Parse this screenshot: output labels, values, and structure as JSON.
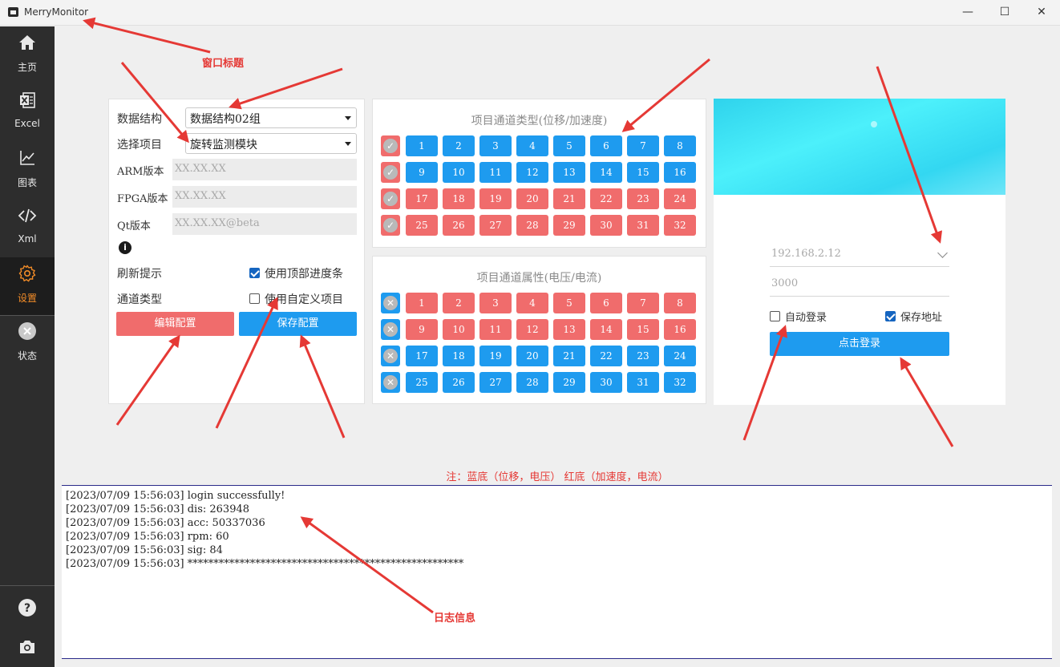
{
  "window": {
    "title": "MerryMonitor",
    "minimize": "—",
    "maximize": "☐",
    "close": "✕"
  },
  "sidebar": {
    "items": [
      {
        "label": "主页",
        "icon": "home-icon"
      },
      {
        "label": "Excel",
        "icon": "excel-icon"
      },
      {
        "label": "图表",
        "icon": "chart-icon"
      },
      {
        "label": "Xml",
        "icon": "code-icon"
      },
      {
        "label": "设置",
        "icon": "gear-icon",
        "active": true
      },
      {
        "label": "状态",
        "icon": "status-icon"
      }
    ],
    "accent": "#f28c28",
    "bottom": [
      "help-icon",
      "camera-icon"
    ]
  },
  "config": {
    "data_structure_label": "数据结构",
    "data_structure_value": "数据结构02组",
    "project_label": "选择项目",
    "project_value": "旋转监测模块",
    "arm_label": "ARM版本",
    "arm_value": "XX.XX.XX",
    "fpga_label": "FPGA版本",
    "fpga_value": "XX.XX.XX",
    "qt_label": "Qt版本",
    "qt_value": "XX.XX.XX@beta",
    "refresh_label": "刷新提示",
    "channel_label": "通道类型",
    "use_progress": {
      "label": "使用顶部进度条",
      "checked": true
    },
    "use_custom": {
      "label": "使用自定义项目",
      "checked": false
    },
    "edit_button": "编辑配置",
    "save_button": "保存配置"
  },
  "channel_type": {
    "title": "项目通道类型(位移/加速度)",
    "rows": [
      {
        "toggle": "check",
        "color": "red",
        "channels": [
          "1",
          "2",
          "3",
          "4",
          "5",
          "6",
          "7",
          "8"
        ],
        "cell_color": "blue"
      },
      {
        "toggle": "check",
        "color": "red",
        "channels": [
          "9",
          "10",
          "11",
          "12",
          "13",
          "14",
          "15",
          "16"
        ],
        "cell_color": "blue"
      },
      {
        "toggle": "check",
        "color": "red",
        "channels": [
          "17",
          "18",
          "19",
          "20",
          "21",
          "22",
          "23",
          "24"
        ],
        "cell_color": "red"
      },
      {
        "toggle": "check",
        "color": "red",
        "channels": [
          "25",
          "26",
          "27",
          "28",
          "29",
          "30",
          "31",
          "32"
        ],
        "cell_color": "red"
      }
    ]
  },
  "channel_attr": {
    "title": "项目通道属性(电压/电流)",
    "rows": [
      {
        "toggle": "cross",
        "color": "blue",
        "channels": [
          "1",
          "2",
          "3",
          "4",
          "5",
          "6",
          "7",
          "8"
        ],
        "cell_color": "red"
      },
      {
        "toggle": "cross",
        "color": "blue",
        "channels": [
          "9",
          "10",
          "11",
          "12",
          "13",
          "14",
          "15",
          "16"
        ],
        "cell_color": "red"
      },
      {
        "toggle": "cross",
        "color": "blue",
        "channels": [
          "17",
          "18",
          "19",
          "20",
          "21",
          "22",
          "23",
          "24"
        ],
        "cell_color": "blue"
      },
      {
        "toggle": "cross",
        "color": "blue",
        "channels": [
          "25",
          "26",
          "27",
          "28",
          "29",
          "30",
          "31",
          "32"
        ],
        "cell_color": "blue"
      }
    ]
  },
  "colors": {
    "blue": "#1e9bef",
    "red": "#f06c6c"
  },
  "login": {
    "ip_placeholder": "192.168.2.12",
    "port_placeholder": "3000",
    "auto_login": {
      "label": "自动登录",
      "checked": false
    },
    "save_address": {
      "label": "保存地址",
      "checked": true
    },
    "login_button": "点击登录"
  },
  "legend": "注：蓝底（位移，电压） 红底（加速度，电流）",
  "log": [
    "[2023/07/09 15:56:03] login successfully!",
    "[2023/07/09 15:56:03] dis: 263948",
    "[2023/07/09 15:56:03] acc: 50337036",
    "[2023/07/09 15:56:03] rpm: 60",
    "[2023/07/09 15:56:03] sig: 84",
    "[2023/07/09 15:56:03] *****************************************************"
  ],
  "annotations": {
    "window_title": "窗口标题",
    "log_info": "日志信息"
  }
}
